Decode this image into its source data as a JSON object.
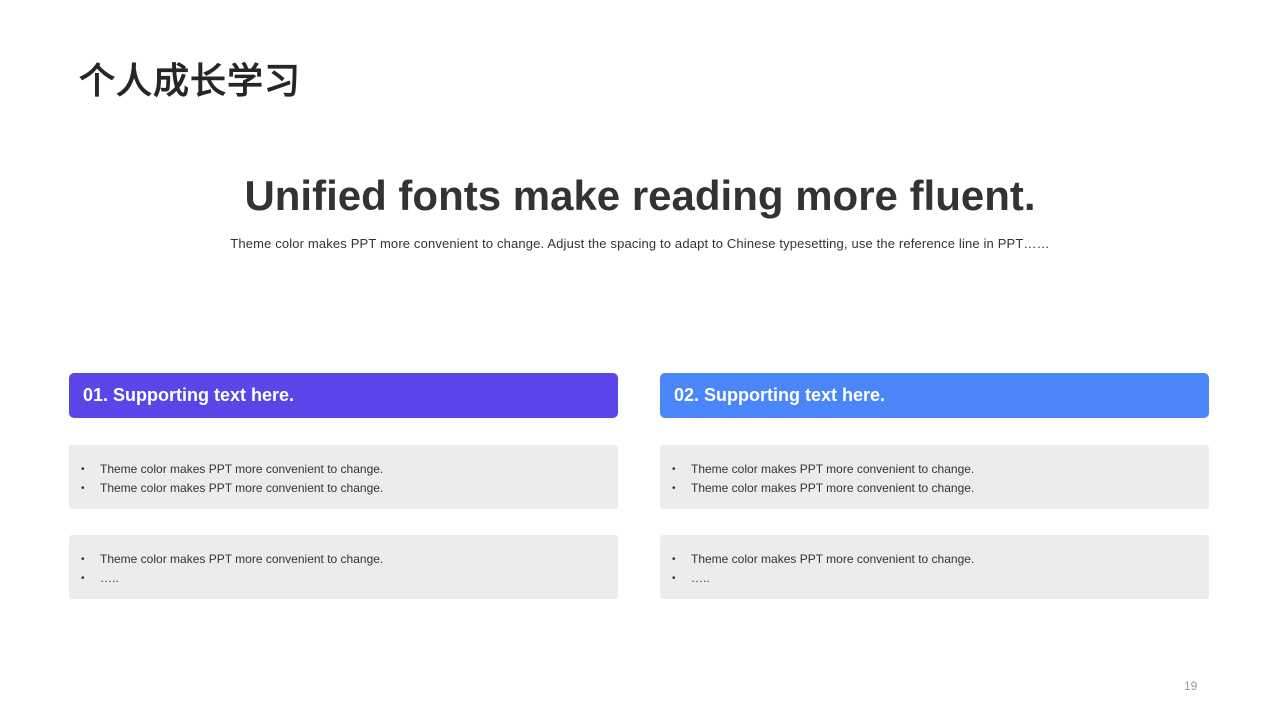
{
  "slide": {
    "title": "个人成长学习",
    "headline": "Unified fonts make reading more fluent.",
    "subtitle": "Theme color makes PPT more convenient to change. Adjust the spacing to adapt to Chinese typesetting, use the reference line in PPT……",
    "page_number": "19"
  },
  "colors": {
    "column_1_header": "#5b45e9",
    "column_2_header": "#4a86f7",
    "box_background": "#ebecee"
  },
  "columns": [
    {
      "header": "01. Supporting text here.",
      "boxes": [
        {
          "items": [
            {
              "bullet": "•",
              "text": "Theme color makes PPT more convenient to change."
            },
            {
              "bullet": "•",
              "text": "Theme color makes PPT more convenient to change."
            }
          ]
        },
        {
          "items": [
            {
              "bullet": "•",
              "text": "Theme color makes PPT more convenient to change."
            },
            {
              "bullet": "•",
              "text": "….."
            }
          ]
        }
      ]
    },
    {
      "header": "02. Supporting text here.",
      "boxes": [
        {
          "items": [
            {
              "bullet": "•",
              "text": "Theme color makes PPT more convenient to change."
            },
            {
              "bullet": "•",
              "text": "Theme color makes PPT more convenient to change."
            }
          ]
        },
        {
          "items": [
            {
              "bullet": "•",
              "text": "Theme color makes PPT more convenient to change."
            },
            {
              "bullet": "•",
              "text": "….."
            }
          ]
        }
      ]
    }
  ]
}
